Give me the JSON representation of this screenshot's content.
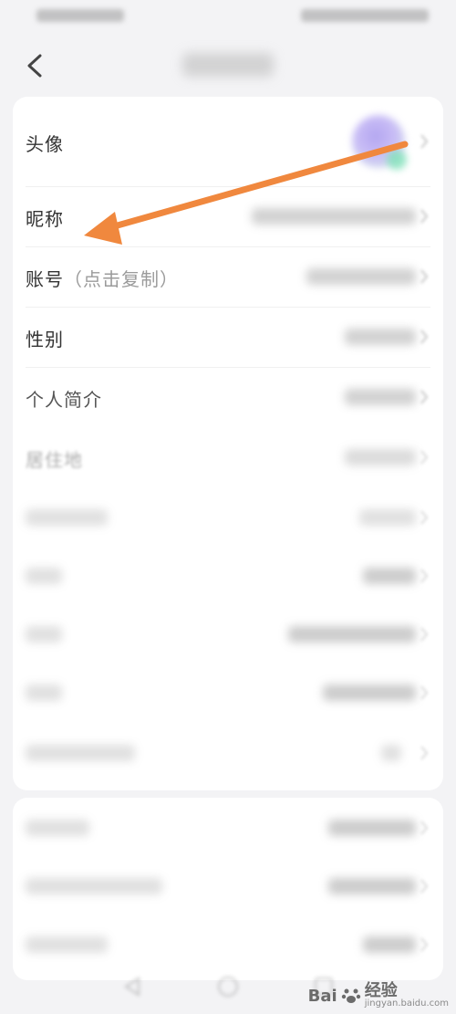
{
  "nav": {
    "back_icon": "chevron-left-icon"
  },
  "profile": {
    "avatar_label": "头像",
    "nickname_label": "昵称",
    "account_label": "账号",
    "account_hint": "（点击复制）",
    "gender_label": "性别",
    "bio_label": "个人简介",
    "residence_label": "居住地"
  },
  "annotation": {
    "arrow_color": "#f0883e"
  },
  "watermark": {
    "brand": "Bai",
    "brand_tail": "经验",
    "url": "jingyan.baidu.com"
  }
}
